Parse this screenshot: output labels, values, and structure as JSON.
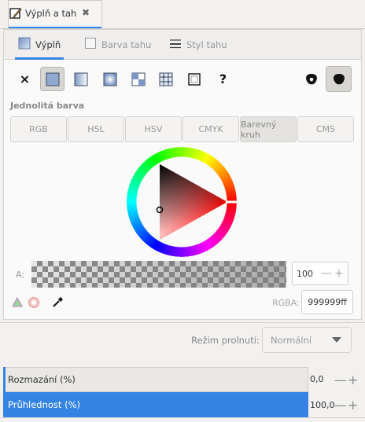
{
  "dock_tab": {
    "label": "Výplň a tah",
    "icon": "fill-stroke-icon",
    "close_icon": "close-icon"
  },
  "subtabs": [
    {
      "label": "Výplň",
      "icon": "fill-swatch-icon",
      "active": true
    },
    {
      "label": "Barva tahu",
      "icon": "stroke-paint-icon",
      "active": false
    },
    {
      "label": "Styl tahu",
      "icon": "stroke-style-icon",
      "active": false
    }
  ],
  "fill_types": {
    "none": "×",
    "unset": "?",
    "selected": "flat-color",
    "items": [
      "no-paint-icon",
      "flat-color-icon",
      "linear-gradient-icon",
      "radial-gradient-icon",
      "pattern-icon",
      "mesh-gradient-icon",
      "swatch-icon",
      "unset-paint-icon"
    ]
  },
  "fill_rule_icons": [
    "fill-rule-evenodd-icon",
    "fill-rule-nonzero-icon"
  ],
  "section_heading": "Jednolitá barva",
  "color_modes": [
    {
      "label": "RGB",
      "selected": false
    },
    {
      "label": "HSL",
      "selected": false
    },
    {
      "label": "HSV",
      "selected": false
    },
    {
      "label": "CMYK",
      "selected": false
    },
    {
      "label": "Barevný kruh",
      "selected": true
    },
    {
      "label": "CMS",
      "selected": false
    }
  ],
  "alpha": {
    "label": "A:",
    "value": "100",
    "minus": "—",
    "plus": "+"
  },
  "rgba": {
    "label": "RGBA:",
    "value": "999999ff"
  },
  "blend": {
    "label": "Režim prolnutí:",
    "value": "Normální"
  },
  "blur": {
    "label": "Rozmazání (%)",
    "value": "0,0",
    "minus": "—",
    "plus": "+"
  },
  "opacity": {
    "label": "Průhlednost (%)",
    "value": "100,0",
    "minus": "—",
    "plus": "+",
    "fraction": 1.0
  },
  "colors": {
    "accent": "#3584e4",
    "current": "#999999",
    "hue": "#ff0000"
  }
}
